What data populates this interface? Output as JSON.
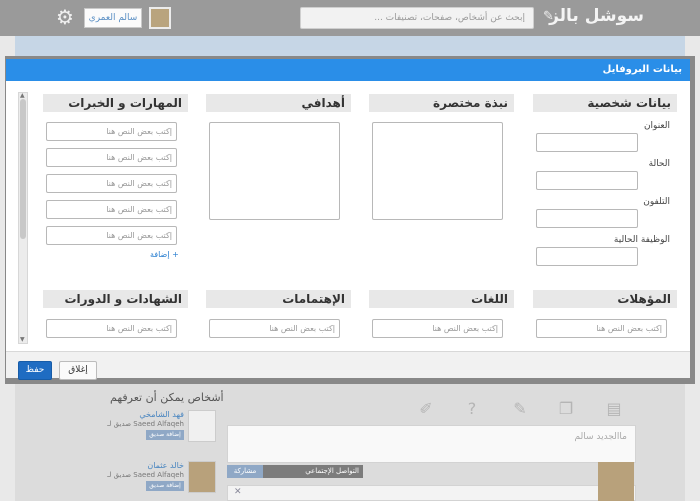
{
  "topbar": {
    "brand": "سوشل بالز",
    "search_placeholder": "إبحث عن أشخاص، صفحات، تصنيفات ...",
    "user_name": "سالم العمري"
  },
  "modal": {
    "title": "بيانات البروفايل",
    "sections_top": [
      {
        "title": "بيانات شخصية"
      },
      {
        "title": "نبذة مختصرة"
      },
      {
        "title": "أهدافي"
      },
      {
        "title": "المهارات و الخبرات"
      }
    ],
    "personal": {
      "address_label": "العنوان",
      "status_label": "الحالة",
      "phone_label": "التلفون",
      "job_label": "الوظيفة الحالية"
    },
    "skills": {
      "placeholders": [
        "إكتب بعض النص هنا",
        "إكتب بعض النص هنا",
        "إكتب بعض النص هنا",
        "إكتب بعض النص هنا",
        "إكتب بعض النص هنا"
      ],
      "add_label": "+ إضافة"
    },
    "sections_bottom": [
      {
        "title": "المؤهلات",
        "placeholder": "إكتب بعض النص هنا"
      },
      {
        "title": "اللغات",
        "placeholder": "إكتب بعض النص هنا"
      },
      {
        "title": "الإهتمامات",
        "placeholder": "إكتب بعض النص هنا"
      },
      {
        "title": "الشهادات و الدورات",
        "placeholder": "إكتب بعض النص هنا"
      }
    ],
    "save_label": "حفظ",
    "close_label": "إغلاق"
  },
  "background": {
    "suggest_title": "أشخاص يمكن أن تعرفهم",
    "people": [
      {
        "name": "فهد الشامخي",
        "sub": "Saeed Alfaqeh صديق لـ",
        "btn": "إضافة صديق"
      },
      {
        "name": "خالد عثمان",
        "sub": "Saeed Alfaqeh صديق لـ",
        "btn": "إضافة صديق"
      }
    ],
    "post_placeholder": "ماالجديد سالم",
    "share_label": "مشاركة",
    "scope_label": "التواصل الإجتماعي"
  }
}
